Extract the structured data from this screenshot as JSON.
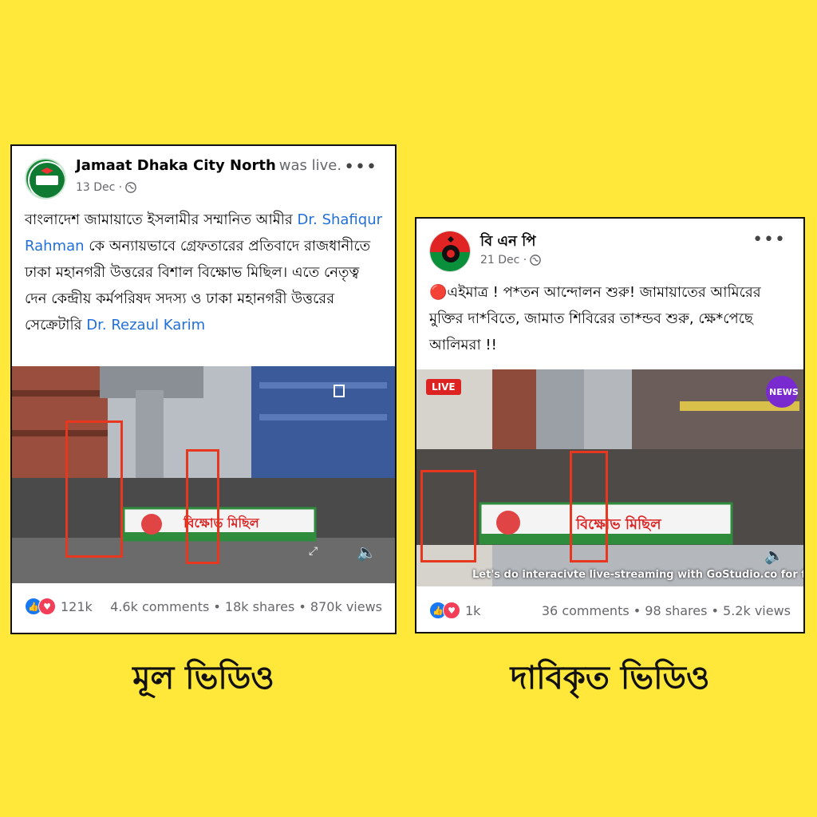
{
  "posts": [
    {
      "page_name": "Jamaat Dhaka City North",
      "status_text": "was live.",
      "date": "13 Dec · ",
      "more": "•••",
      "text": {
        "p1": "বাংলাদেশ জামায়াতে ইসলামীর সম্মানিত আমীর ",
        "link1": "Dr. Shafiqur Rahman",
        "p2": " কে অন্যায়ভাবে গ্রেফতারের প্রতিবাদে রাজধানীতে ঢাকা মহানগরী উত্তরের বিশাল বিক্ষোভ মিছিল। এতে নেতৃত্ব দেন কেন্দ্রীয় কর্মপরিষদ সদস্য ও ঢাকা মহানগরী উত্তরের সেক্রেটারি ",
        "link2": "Dr. Rezaul Karim"
      },
      "video_banner": "বিক্ষোভ মিছিল",
      "reactions": "121k",
      "stats": "4.6k comments • 18k shares • 870k views",
      "caption": "মূল ভিডিও"
    },
    {
      "page_name": "বি এন পি",
      "date": "21 Dec · ",
      "more": "•••",
      "text": "🔴এইমাত্র ! প*তন আন্দোলন শুরু!  জামায়াতের আমিরের মুক্তির দা*বিতে, জামাত শিবিরের তা*ন্ডব শুরু,  ক্ষে*পেছে  আলিমরা !!",
      "live_badge": "LIVE",
      "news_logo": "NEWS",
      "video_banner": "বিক্ষোভ মিছিল",
      "overlay": "Let's do interacivte live-streaming with GoStudio.co for free",
      "reactions": "1k",
      "stats": "36 comments • 98 shares • 5.2k views",
      "caption": "দাবিকৃত ভিডিও"
    }
  ],
  "colors": {
    "background": "#FFE83A",
    "link": "#216fdb",
    "highlight": "#e8371f",
    "like": "#1877f2",
    "love": "#f33e58"
  }
}
